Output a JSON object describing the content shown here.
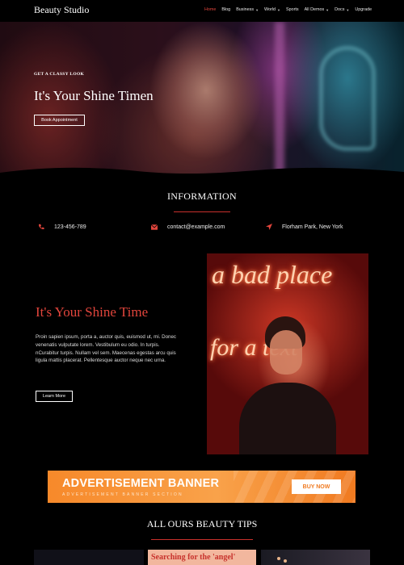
{
  "header": {
    "brand": "Beauty Studio",
    "nav": [
      {
        "label": "Home",
        "active": true,
        "has_dropdown": false
      },
      {
        "label": "Blog",
        "active": false,
        "has_dropdown": false
      },
      {
        "label": "Business",
        "active": false,
        "has_dropdown": true
      },
      {
        "label": "World",
        "active": false,
        "has_dropdown": true
      },
      {
        "label": "Sports",
        "active": false,
        "has_dropdown": false
      },
      {
        "label": "All Demos",
        "active": false,
        "has_dropdown": true
      },
      {
        "label": "Docs",
        "active": false,
        "has_dropdown": true
      },
      {
        "label": "Upgrade",
        "active": false,
        "has_dropdown": false
      }
    ]
  },
  "hero": {
    "eyebrow": "GET A CLASSY LOOK",
    "title": "It's Your Shine Timen",
    "button": "Book Appointment"
  },
  "information": {
    "title": "INFORMATION",
    "items": [
      {
        "icon": "phone-icon",
        "text": "123-456-789"
      },
      {
        "icon": "mail-icon",
        "text": "contact@example.com"
      },
      {
        "icon": "location-arrow-icon",
        "text": "Florham Park, New York"
      }
    ]
  },
  "feature": {
    "title": "It's Your Shine Time",
    "body": "Proin sapien ipsum, porta a, auctor quis, euismod ut, mi. Donec venenatis vulputate lorem. Vestibulum eu odio. In turpis. nCurabitur turpis. Nullam vel sem. Maecenas egestas arcu quis ligula mattis placerat. Pellentesque auctor neque nec urna.",
    "button": "Learn More",
    "neon_sign": [
      "a bad place",
      "for a text"
    ]
  },
  "ad": {
    "title": "ADVERTISEMENT BANNER",
    "subtitle": "ADVERTISEMENT BANNER SECTION",
    "button": "BUY NOW"
  },
  "tips": {
    "title": "ALL OURS BEAUTY TIPS",
    "cards": [
      {
        "label": ""
      },
      {
        "label": "Searching for the 'angel'"
      },
      {
        "label": ""
      }
    ]
  },
  "colors": {
    "accent": "#e2453c",
    "background": "#000000",
    "ad_orange": "#f7892a"
  }
}
